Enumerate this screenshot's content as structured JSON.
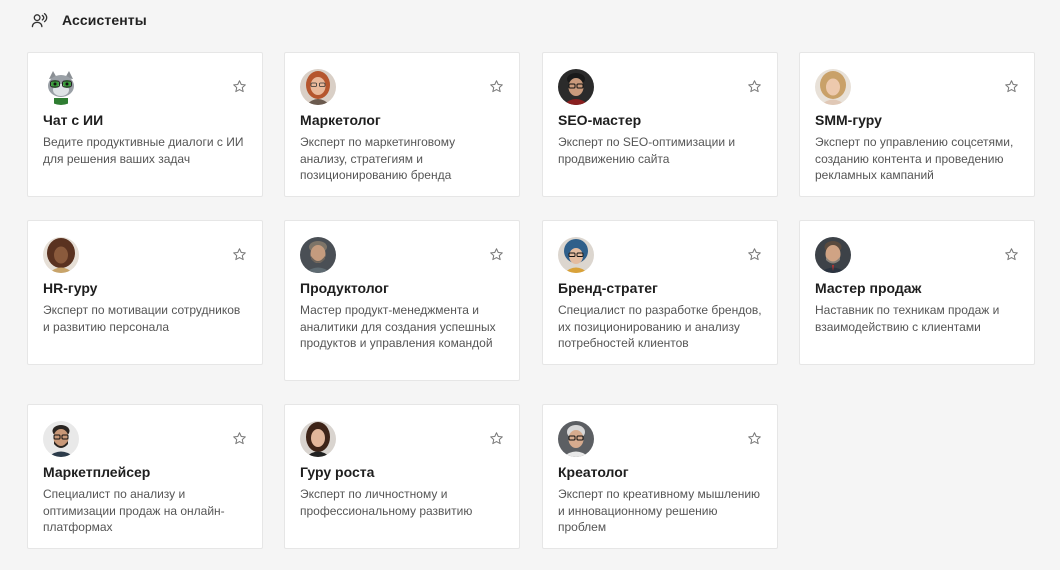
{
  "header": {
    "icon": "voice-assistant-icon",
    "title": "Ассистенты"
  },
  "cards": [
    {
      "title": "Чат с ИИ",
      "description": "Ведите продуктивные диалоги с ИИ для решения ваших задач",
      "avatar": "cat-mascot-avatar",
      "favorite_icon": "star-outline-icon"
    },
    {
      "title": "Маркетолог",
      "description": "Эксперт по маркетинговому анализу, стратегиям и позиционированию бренда",
      "avatar": "woman-redhead-glasses-avatar",
      "favorite_icon": "star-outline-icon"
    },
    {
      "title": "SEO-мастер",
      "description": "Эксперт по SEO-оптимизации и продвижению сайта",
      "avatar": "man-glasses-avatar",
      "favorite_icon": "star-outline-icon"
    },
    {
      "title": "SMM-гуру",
      "description": "Эксперт по управлению соцсетями, созданию контента и проведению рекламных кампаний",
      "avatar": "woman-curly-blonde-avatar",
      "favorite_icon": "star-outline-icon"
    },
    {
      "title": "HR-гуру",
      "description": "Эксперт по мотивации сотрудников и развитию персонала",
      "avatar": "woman-curly-dark-avatar",
      "favorite_icon": "star-outline-icon"
    },
    {
      "title": "Продуктолог",
      "description": "Мастер продукт-менеджмента и аналитики для создания успешных продуктов и управления командой",
      "avatar": "man-beard-gray-avatar",
      "favorite_icon": "star-outline-icon"
    },
    {
      "title": "Бренд-стратег",
      "description": "Специалист по разработке брендов, их позиционированию и анализу потребностей клиентов",
      "avatar": "woman-blue-hair-glasses-avatar",
      "favorite_icon": "star-outline-icon"
    },
    {
      "title": "Мастер продаж",
      "description": "Наставник по техникам продаж и взаимодействию с клиентами",
      "avatar": "man-beard-suit-avatar",
      "favorite_icon": "star-outline-icon"
    },
    {
      "title": "Маркетплейсер",
      "description": "Специалист по анализу и оптимизации продаж на онлайн-платформах",
      "avatar": "man-beard-glasses-avatar",
      "favorite_icon": "star-outline-icon"
    },
    {
      "title": "Гуру роста",
      "description": "Эксперт по личностному и профессиональному развитию",
      "avatar": "woman-brunette-avatar",
      "favorite_icon": "star-outline-icon"
    },
    {
      "title": "Креатолог",
      "description": "Эксперт по креативному мышлению и инновационному решению проблем",
      "avatar": "man-gray-hair-glasses-avatar",
      "favorite_icon": "star-outline-icon"
    }
  ]
}
